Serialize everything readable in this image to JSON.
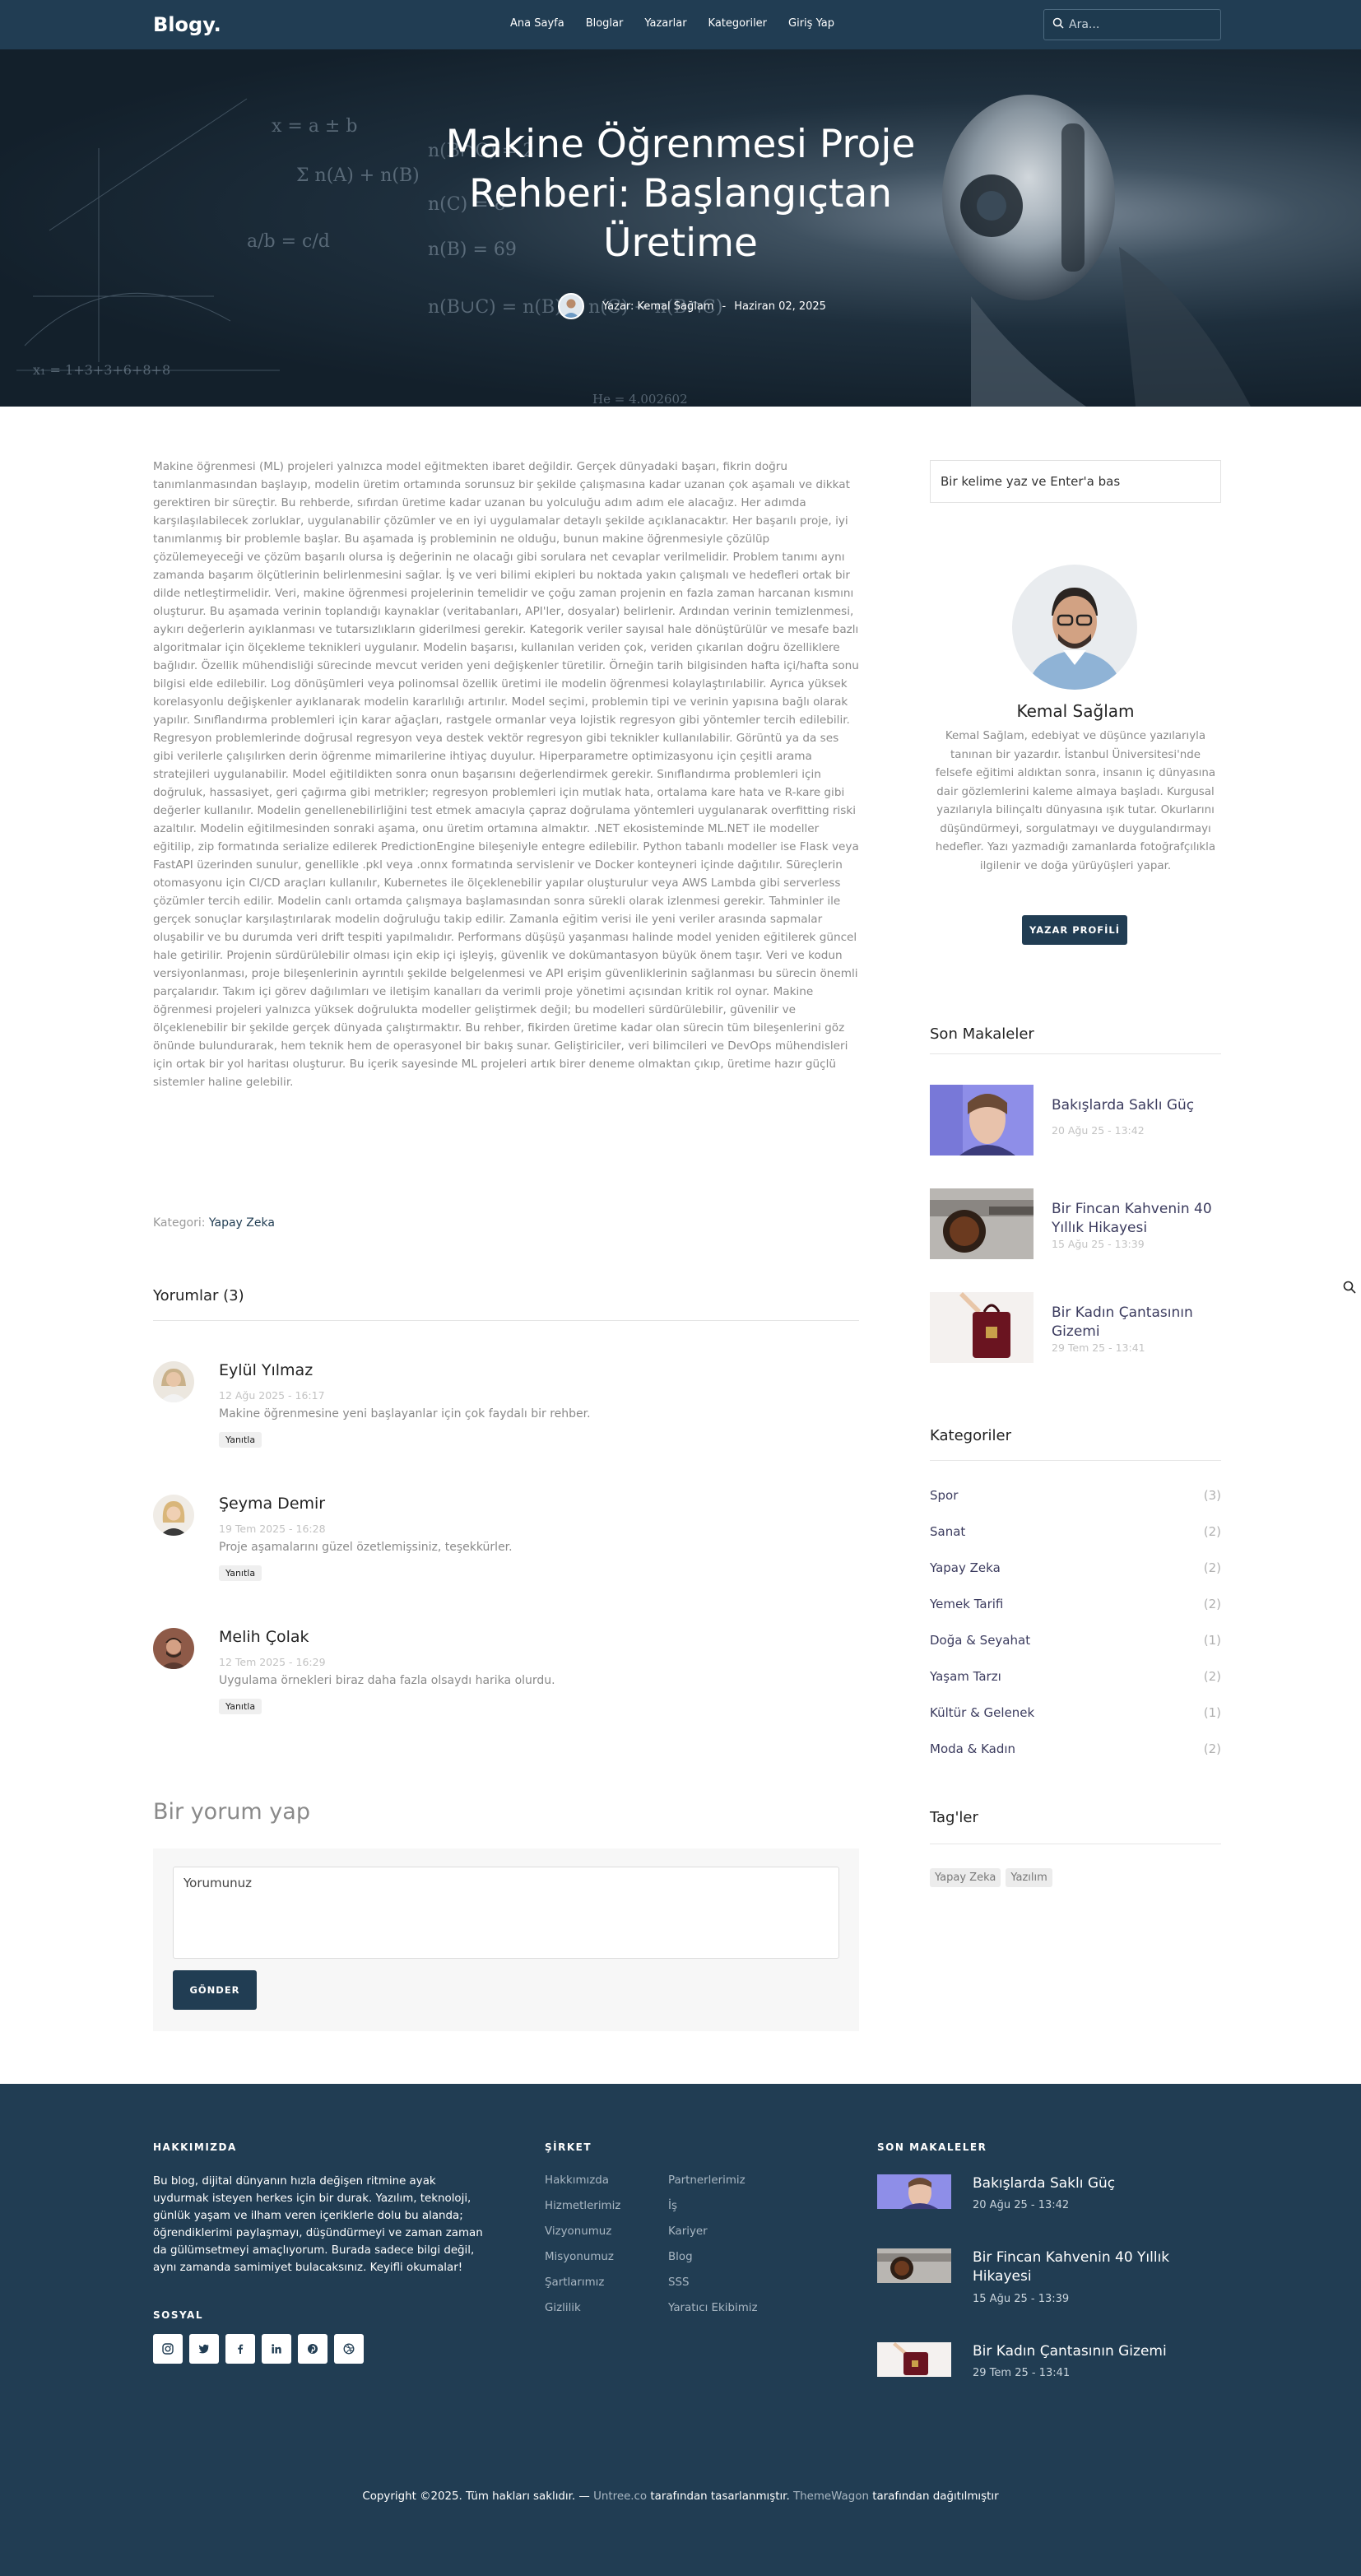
{
  "nav": {
    "logo": "Blogy.",
    "links": [
      "Ana Sayfa",
      "Bloglar",
      "Yazarlar",
      "Kategoriler",
      "Giriş Yap"
    ],
    "search_placeholder": "Ara..."
  },
  "hero": {
    "title": "Makine Öğrenmesi Proje Rehberi: Başlangıçtan Üretime",
    "author": "Yazar: Kemal Sağlam",
    "separator": "-",
    "date": "Haziran 02, 2025"
  },
  "article": {
    "body": "Makine öğrenmesi (ML) projeleri yalnızca model eğitmekten ibaret değildir. Gerçek dünyadaki başarı, fikrin doğru tanımlanmasından başlayıp, modelin üretim ortamında sorunsuz bir şekilde çalışmasına kadar uzanan çok aşamalı ve dikkat gerektiren bir süreçtir. Bu rehberde, sıfırdan üretime kadar uzanan bu yolculuğu adım adım ele alacağız. Her adımda karşılaşılabilecek zorluklar, uygulanabilir çözümler ve en iyi uygulamalar detaylı şekilde açıklanacaktır. Her başarılı proje, iyi tanımlanmış bir problemle başlar. Bu aşamada iş probleminin ne olduğu, bunun makine öğrenmesiyle çözülüp çözülemeyeceği ve çözüm başarılı olursa iş değerinin ne olacağı gibi sorulara net cevaplar verilmelidir. Problem tanımı aynı zamanda başarım ölçütlerinin belirlenmesini sağlar. İş ve veri bilimi ekipleri bu noktada yakın çalışmalı ve hedefleri ortak bir dilde netleştirmelidir. Veri, makine öğrenmesi projelerinin temelidir ve çoğu zaman projenin en fazla zaman harcanan kısmını oluşturur. Bu aşamada verinin toplandığı kaynaklar (veritabanları, API'ler, dosyalar) belirlenir. Ardından verinin temizlenmesi, aykırı değerlerin ayıklanması ve tutarsızlıkların giderilmesi gerekir. Kategorik veriler sayısal hale dönüştürülür ve mesafe bazlı algoritmalar için ölçekleme teknikleri uygulanır. Modelin başarısı, kullanılan veriden çok, veriden çıkarılan doğru özelliklere bağlıdır. Özellik mühendisliği sürecinde mevcut veriden yeni değişkenler türetilir. Örneğin tarih bilgisinden hafta içi/hafta sonu bilgisi elde edilebilir. Log dönüşümleri veya polinomsal özellik üretimi ile modelin öğrenmesi kolaylaştırılabilir. Ayrıca yüksek korelasyonlu değişkenler ayıklanarak modelin kararlılığı artırılır. Model seçimi, problemin tipi ve verinin yapısına bağlı olarak yapılır. Sınıflandırma problemleri için karar ağaçları, rastgele ormanlar veya lojistik regresyon gibi yöntemler tercih edilebilir. Regresyon problemlerinde doğrusal regresyon veya destek vektör regresyon gibi teknikler kullanılabilir. Görüntü ya da ses gibi verilerle çalışılırken derin öğrenme mimarilerine ihtiyaç duyulur. Hiperparametre optimizasyonu için çeşitli arama stratejileri uygulanabilir. Model eğitildikten sonra onun başarısını değerlendirmek gerekir. Sınıflandırma problemleri için doğruluk, hassasiyet, geri çağırma gibi metrikler; regresyon problemleri için mutlak hata, ortalama kare hata ve R-kare gibi değerler kullanılır. Modelin genellenebilirliğini test etmek amacıyla çapraz doğrulama yöntemleri uygulanarak overfitting riski azaltılır. Modelin eğitilmesinden sonraki aşama, onu üretim ortamına almaktır. .NET ekosisteminde ML.NET ile modeller eğitilip, zip formatında serialize edilerek PredictionEngine bileşeniyle entegre edilebilir. Python tabanlı modeller ise Flask veya FastAPI üzerinden sunulur, genellikle .pkl veya .onnx formatında servislenir ve Docker konteyneri içinde dağıtılır. Süreçlerin otomasyonu için CI/CD araçları kullanılır, Kubernetes ile ölçeklenebilir yapılar oluşturulur veya AWS Lambda gibi serverless çözümler tercih edilir. Modelin canlı ortamda çalışmaya başlamasından sonra sürekli olarak izlenmesi gerekir. Tahminler ile gerçek sonuçlar karşılaştırılarak modelin doğruluğu takip edilir. Zamanla eğitim verisi ile yeni veriler arasında sapmalar oluşabilir ve bu durumda veri drift tespiti yapılmalıdır. Performans düşüşü yaşanması halinde model yeniden eğitilerek güncel hale getirilir. Projenin sürdürülebilir olması için ekip içi işleyiş, güvenlik ve dokümantasyon büyük önem taşır. Veri ve kodun versiyonlanması, proje bileşenlerinin ayrıntılı şekilde belgelenmesi ve API erişim güvenliklerinin sağlanması bu sürecin önemli parçalarıdır. Takım içi görev dağılımları ve iletişim kanalları da verimli proje yönetimi açısından kritik rol oynar. Makine öğrenmesi projeleri yalnızca yüksek doğrulukta modeller geliştirmek değil; bu modelleri sürdürülebilir, güvenilir ve ölçeklenebilir bir şekilde gerçek dünyada çalıştırmaktır. Bu rehber, fikirden üretime kadar olan sürecin tüm bileşenlerini göz önünde bulundurarak, hem teknik hem de operasyonel bir bakış sunar. Geliştiriciler, veri bilimcileri ve DevOps mühendisleri için ortak bir yol haritası oluşturur. Bu içerik sayesinde ML projeleri artık birer deneme olmaktan çıkıp, üretime hazır güçlü sistemler haline gelebilir.",
    "category_label": "Kategori: ",
    "category": "Yapay Zeka"
  },
  "comments": {
    "title": "Yorumlar (3)",
    "reply_label": "Yanıtla",
    "items": [
      {
        "name": "Eylül Yılmaz",
        "date": "12 Ağu 2025 - 16:17",
        "text": "Makine öğrenmesine yeni başlayanlar için çok faydalı bir rehber."
      },
      {
        "name": "Şeyma Demir",
        "date": "19 Tem 2025 - 16:28",
        "text": "Proje aşamalarını güzel özetlemişsiniz, teşekkürler."
      },
      {
        "name": "Melih Çolak",
        "date": "12 Tem 2025 - 16:29",
        "text": "Uygulama örnekleri biraz daha fazla olsaydı harika olurdu."
      }
    ]
  },
  "comment_form": {
    "title": "Bir yorum yap",
    "placeholder": "Yorumunuz",
    "submit": "GÖNDER"
  },
  "sidebar": {
    "search_placeholder": "Bir kelime yaz ve Enter'a bas",
    "author": {
      "name": "Kemal Sağlam",
      "bio": "Kemal Sağlam, edebiyat ve düşünce yazılarıyla tanınan bir yazardır. İstanbul Üniversitesi'nde felsefe eğitimi aldıktan sonra, insanın iç dünyasına dair gözlemlerini kaleme almaya başladı. Kurgusal yazılarıyla bilinçaltı dünyasına ışık tutar. Okurlarını düşündürmeyi, sorgulatmayı ve duygulandırmayı hedefler. Yazı yazmadığı zamanlarda fotoğrafçılıkla ilgilenir ve doğa yürüyüşleri yapar.",
      "button": "YAZAR PROFİLİ"
    },
    "recent_title": "Son Makaleler",
    "recent": [
      {
        "title": "Bakışlarda Saklı Güç",
        "date": "20 Ağu 25 - 13:42"
      },
      {
        "title": "Bir Fincan Kahvenin 40 Yıllık Hikayesi",
        "date": "15 Ağu 25 - 13:39"
      },
      {
        "title": "Bir Kadın Çantasının Gizemi",
        "date": "29 Tem 25 - 13:41"
      }
    ],
    "categories_title": "Kategoriler",
    "categories": [
      {
        "name": "Spor",
        "count": "(3)"
      },
      {
        "name": "Sanat",
        "count": "(2)"
      },
      {
        "name": "Yapay Zeka",
        "count": "(2)"
      },
      {
        "name": "Yemek Tarifi",
        "count": "(2)"
      },
      {
        "name": "Doğa & Seyahat",
        "count": "(1)"
      },
      {
        "name": "Yaşam Tarzı",
        "count": "(2)"
      },
      {
        "name": "Kültür & Gelenek",
        "count": "(1)"
      },
      {
        "name": "Moda & Kadın",
        "count": "(2)"
      }
    ],
    "tags_title": "Tag'ler",
    "tags": [
      "Yapay Zeka",
      "Yazılım"
    ]
  },
  "footer": {
    "about_title": "HAKKIMIZDA",
    "about_text": "Bu blog, dijital dünyanın hızla değişen ritmine ayak uydurmak isteyen herkes için bir durak. Yazılım, teknoloji, günlük yaşam ve ilham veren içeriklerle dolu bu alanda; öğrendiklerimi paylaşmayı, düşündürmeyi ve zaman zaman da gülümsetmeyi amaçlıyorum. Burada sadece bilgi değil, aynı zamanda samimiyet bulacaksınız. Keyifli okumalar!",
    "social_title": "SOSYAL",
    "social_icons": [
      "instagram-icon",
      "twitter-icon",
      "facebook-icon",
      "linkedin-icon",
      "pinterest-icon",
      "dribbble-icon"
    ],
    "company_title": "ŞİRKET",
    "company_col1": [
      "Hakkımızda",
      "Hizmetlerimiz",
      "Vizyonumuz",
      "Misyonumuz",
      "Şartlarımız",
      "Gizlilik"
    ],
    "company_col2": [
      "Partnerlerimiz",
      "İş",
      "Kariyer",
      "Blog",
      "SSS",
      "Yaratıcı Ekibimiz"
    ],
    "recent_title": "SON MAKALELER",
    "recent": [
      {
        "title": "Bakışlarda Saklı Güç",
        "date": "20 Ağu 25 - 13:42"
      },
      {
        "title": "Bir Fincan Kahvenin 40 Yıllık Hikayesi",
        "date": "15 Ağu 25 - 13:39"
      },
      {
        "title": "Bir Kadın Çantasının Gizemi",
        "date": "29 Tem 25 - 13:41"
      }
    ],
    "copyright_pre": "Copyright ©2025. Tüm hakları saklıdır. — ",
    "copyright_link1": "Untree.co",
    "copyright_mid": " tarafından tasarlanmıştır. ",
    "copyright_link2": "ThemeWagon",
    "copyright_post": " tarafından dağıtılmıştır"
  },
  "colors": {
    "primary": "#213d53",
    "link": "#3b3b5e",
    "muted": "#8a8a8a"
  }
}
